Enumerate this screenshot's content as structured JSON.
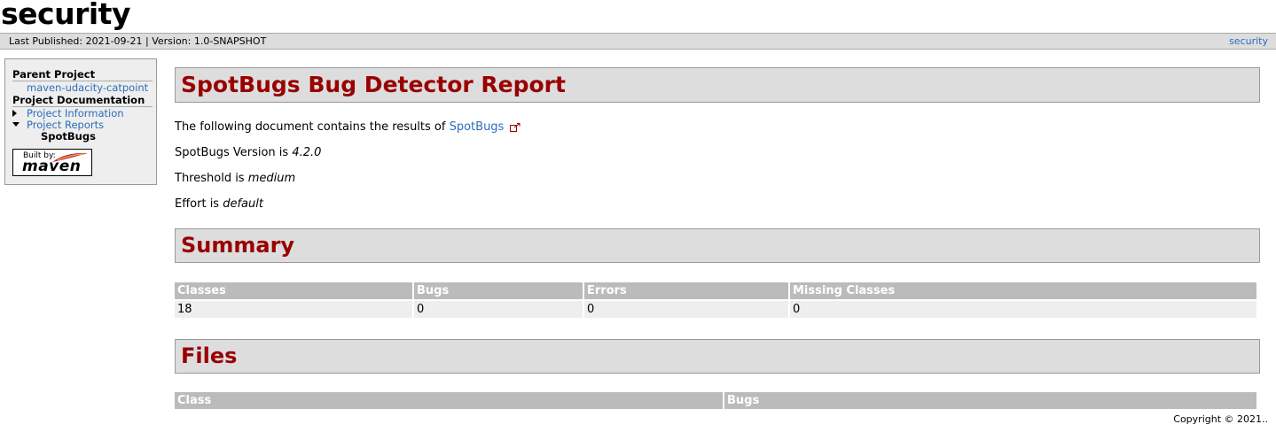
{
  "banner": {
    "title": "security"
  },
  "breadcrumbs": {
    "published": "Last Published: 2021-09-21  | Version: 1.0-SNAPSHOT",
    "right_link": "security"
  },
  "sidebar": {
    "parent_heading": "Parent Project",
    "parent_link": "maven-udacity-catpoint",
    "docs_heading": "Project Documentation",
    "items": [
      {
        "label": "Project Information",
        "state": "collapsed"
      },
      {
        "label": "Project Reports",
        "state": "expanded"
      }
    ],
    "current": "SpotBugs",
    "badge": {
      "built_by": "Built by:",
      "word": "maven"
    }
  },
  "main": {
    "title": "SpotBugs Bug Detector Report",
    "intro_prefix": "The following document contains the results of ",
    "intro_link": "SpotBugs",
    "version_prefix": "SpotBugs Version is ",
    "version_value": "4.2.0",
    "threshold_prefix": "Threshold is ",
    "threshold_value": "medium",
    "effort_prefix": "Effort is ",
    "effort_value": "default",
    "summary_title": "Summary",
    "summary_headers": [
      "Classes",
      "Bugs",
      "Errors",
      "Missing Classes"
    ],
    "summary_row": [
      "18",
      "0",
      "0",
      "0"
    ],
    "files_title": "Files",
    "files_headers": [
      "Class",
      "Bugs"
    ]
  },
  "footer": {
    "copyright": "Copyright © 2021.."
  },
  "colors": {
    "section_title": "#990000",
    "link": "#2a6ebb",
    "bar_bg": "#dddddd",
    "table_header": "#bbbbbb"
  }
}
